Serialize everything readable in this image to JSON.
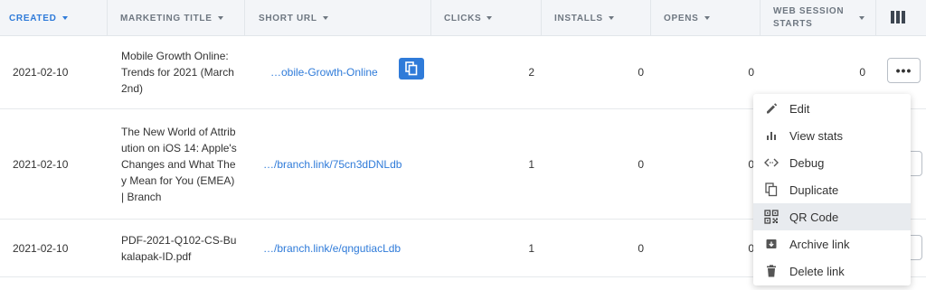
{
  "columns": {
    "created": "CREATED",
    "marketing_title": "MARKETING TITLE",
    "short_url": "SHORT URL",
    "clicks": "CLICKS",
    "installs": "INSTALLS",
    "opens": "OPENS",
    "web_session_starts": "WEB SESSION STARTS"
  },
  "rows": [
    {
      "created": "2021-02-10",
      "title": "Mobile Growth Online: Trends for 2021 (March 2nd)",
      "short_url": "…obile-Growth-Online",
      "clicks": "2",
      "installs": "0",
      "opens": "0",
      "web_session_starts": "0"
    },
    {
      "created": "2021-02-10",
      "title": "The New World of Attribution on iOS 14: Apple's Changes and What They Mean for You (EMEA) | Branch",
      "short_url": "…/branch.link/75cn3dDNLdb",
      "clicks": "1",
      "installs": "0",
      "opens": "0"
    },
    {
      "created": "2021-02-10",
      "title": "PDF-2021-Q102-CS-Bukalapak-ID.pdf",
      "short_url": "…/branch.link/e/qngutiacLdb",
      "clicks": "1",
      "installs": "0",
      "opens": "0"
    }
  ],
  "more_button_label": "•••",
  "context_menu": {
    "items": [
      {
        "label": "Edit",
        "icon": "pencil-icon"
      },
      {
        "label": "View stats",
        "icon": "bar-chart-icon"
      },
      {
        "label": "Debug",
        "icon": "code-icon"
      },
      {
        "label": "Duplicate",
        "icon": "duplicate-icon"
      },
      {
        "label": "QR Code",
        "icon": "qr-code-icon"
      },
      {
        "label": "Archive link",
        "icon": "archive-icon"
      },
      {
        "label": "Delete link",
        "icon": "trash-icon"
      }
    ],
    "highlighted": "QR Code"
  },
  "colors": {
    "accent": "#2f7bd9",
    "header_bg": "#f3f5f8",
    "menu_highlight": "#e8ebef"
  }
}
